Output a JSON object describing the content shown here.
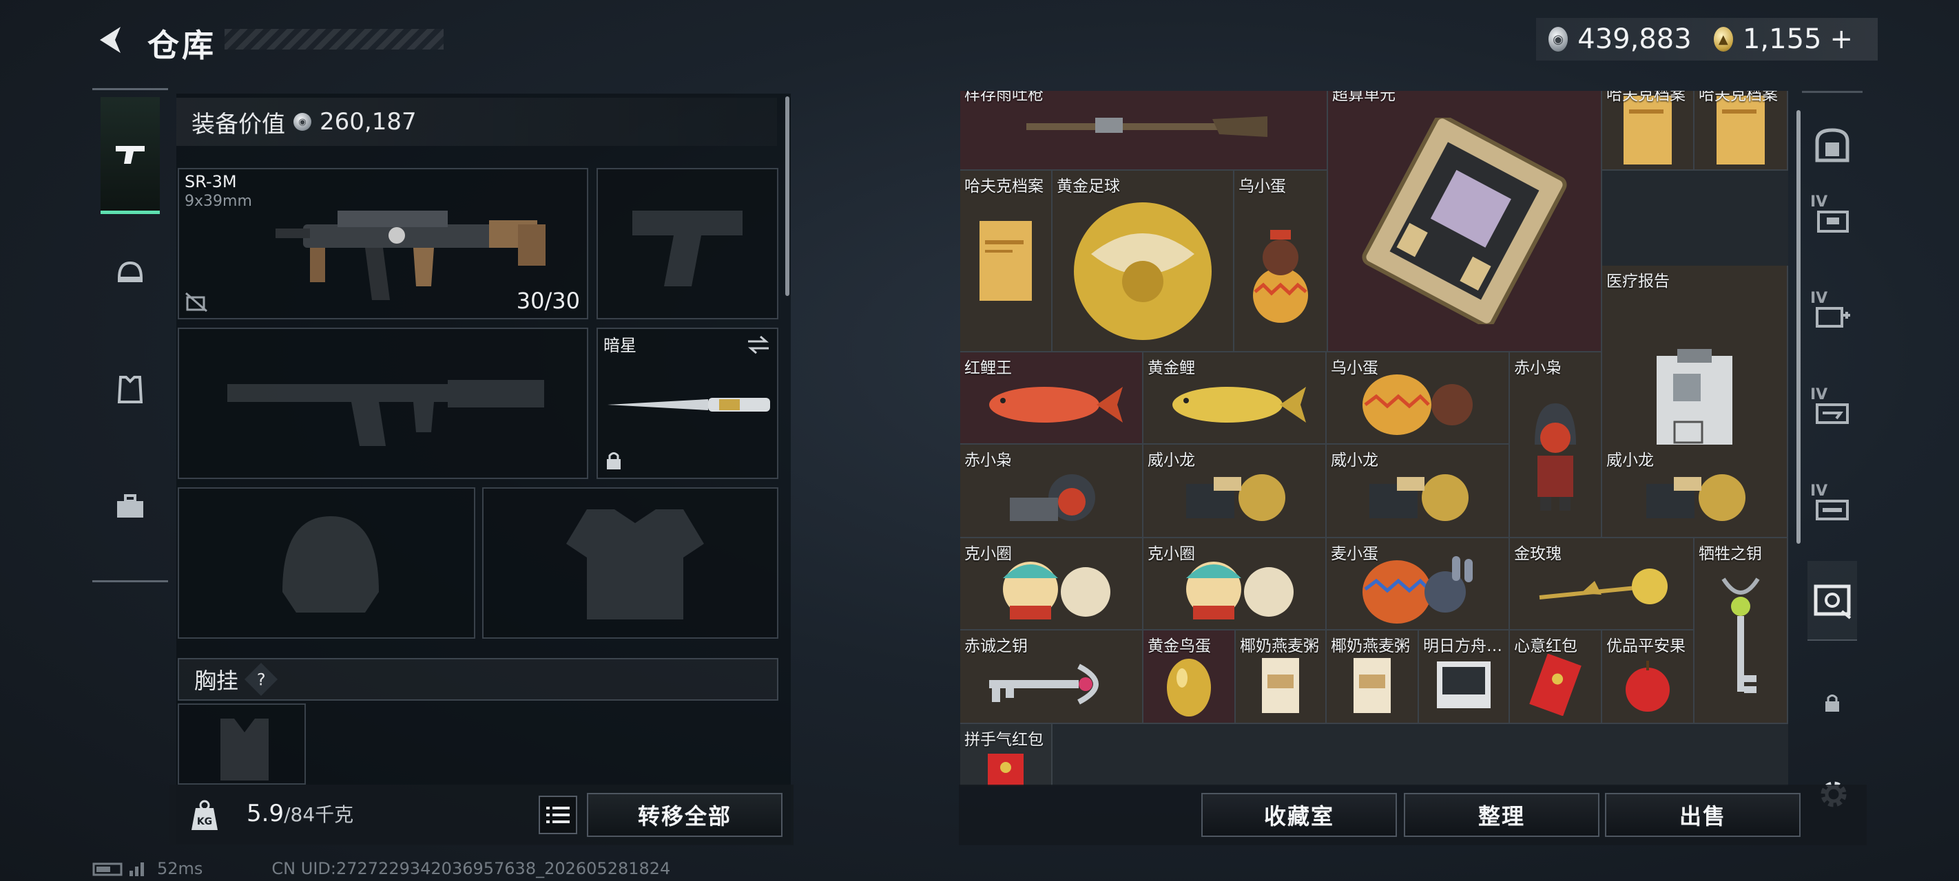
{
  "header": {
    "title": "仓库"
  },
  "currency": {
    "silver": "439,883",
    "gold": "1,155",
    "gold_add": "+"
  },
  "left_tabs": [
    {
      "icon": "pistol-icon",
      "active": true
    },
    {
      "icon": "helmet-icon",
      "active": false
    },
    {
      "icon": "vest-icon",
      "active": false
    },
    {
      "icon": "toolbox-icon",
      "active": false
    }
  ],
  "equipment": {
    "value_label": "装备价值",
    "value": "260,187",
    "primary_weapon": {
      "name": "SR-3M",
      "caliber": "9x39mm",
      "ammo": "30/30"
    },
    "melee": {
      "name": "暗星"
    },
    "chest_label": "胸挂",
    "chest_help": "?"
  },
  "weight": {
    "current": "5.9",
    "max": "/84千克",
    "kg_badge": "KG"
  },
  "buttons": {
    "transfer_all": "转移全部",
    "collection": "收藏室",
    "organize": "整理",
    "sell": "出售"
  },
  "storage": {
    "top_partial": [
      "样存雨吐枪",
      "超算单元",
      "哈夫克档案",
      "哈夫克档案"
    ],
    "items": [
      {
        "label": "哈夫克档案",
        "icon": "document-folder-icon"
      },
      {
        "label": "黄金足球",
        "icon": "gold-football-icon"
      },
      {
        "label": "乌小蛋",
        "icon": "egg-figure-icon"
      },
      {
        "label": "医疗报告",
        "icon": "clipboard-icon"
      },
      {
        "label": "红鲤王",
        "icon": "red-carp-icon"
      },
      {
        "label": "黄金鲤",
        "icon": "gold-carp-icon"
      },
      {
        "label": "乌小蛋",
        "icon": "egg-figure-icon"
      },
      {
        "label": "赤小枭",
        "icon": "hooded-figure-icon"
      },
      {
        "label": "赤小枭",
        "icon": "hooded-figure-icon"
      },
      {
        "label": "威小龙",
        "icon": "dragon-figure-icon"
      },
      {
        "label": "威小龙",
        "icon": "dragon-figure-icon"
      },
      {
        "label": "威小龙",
        "icon": "dragon-figure-icon"
      },
      {
        "label": "克小圈",
        "icon": "toy-figure-icon"
      },
      {
        "label": "克小圈",
        "icon": "toy-figure-icon"
      },
      {
        "label": "麦小蛋",
        "icon": "bunny-egg-icon"
      },
      {
        "label": "金玫瑰",
        "icon": "gold-rose-icon"
      },
      {
        "label": "牺牲之钥",
        "icon": "ornate-key-icon"
      },
      {
        "label": "赤诚之钥",
        "icon": "key-icon"
      },
      {
        "label": "黄金鸟蛋",
        "icon": "gold-egg-icon"
      },
      {
        "label": "椰奶燕麦粥",
        "icon": "food-pack-icon"
      },
      {
        "label": "椰奶燕麦粥",
        "icon": "food-pack-icon"
      },
      {
        "label": "明日方舟…",
        "icon": "card-icon"
      },
      {
        "label": "心意红包",
        "icon": "red-envelope-icon"
      },
      {
        "label": "优品平安果",
        "icon": "apple-icon"
      },
      {
        "label": "拼手气红包",
        "icon": "red-envelope-icon"
      }
    ]
  },
  "right_tabs": [
    "safe-icon",
    "IV",
    "IV",
    "IV",
    "IV",
    "vault-icon",
    "lock-icon"
  ],
  "status": {
    "ping": "52ms",
    "uid": "CN UID:2727229342036957638_202605281824"
  },
  "colors": {
    "accent": "#5ee0b0",
    "red_rarity": "#3a2529",
    "storage_bg": "#23292f"
  }
}
